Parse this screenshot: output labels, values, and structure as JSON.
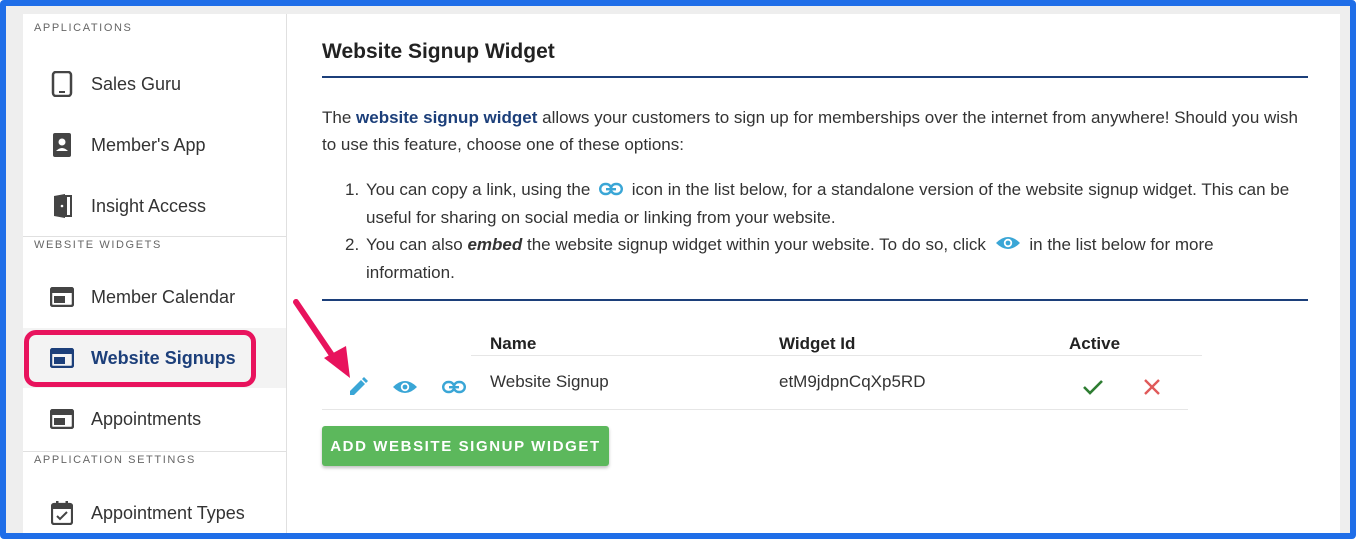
{
  "sidebar": {
    "sections": [
      {
        "title": "APPLICATIONS"
      },
      {
        "title": "WEBSITE WIDGETS"
      },
      {
        "title": "APPLICATION SETTINGS"
      }
    ],
    "items": [
      {
        "label": "Sales Guru",
        "icon": "tablet-icon"
      },
      {
        "label": "Member's App",
        "icon": "phone-id-icon"
      },
      {
        "label": "Insight Access",
        "icon": "door-icon"
      },
      {
        "label": "Member Calendar",
        "icon": "widget-window-icon"
      },
      {
        "label": "Website Signups",
        "icon": "widget-window-icon",
        "active": true
      },
      {
        "label": "Appointments",
        "icon": "widget-window-icon"
      },
      {
        "label": "Appointment Types",
        "icon": "calendar-check-icon"
      }
    ]
  },
  "main": {
    "title": "Website Signup Widget",
    "intro": {
      "prefix": "The ",
      "link": "website signup widget",
      "suffix": " allows your customers to sign up for memberships over the internet from anywhere! Should you wish to use this feature, choose one of these options:"
    },
    "options": [
      {
        "num": "1.",
        "before": "You can copy a link, using the",
        "after": "icon in the list below, for a standalone version of the website signup widget. This can be useful for sharing on social media or linking from your website."
      },
      {
        "num": "2.",
        "before": "You can also ",
        "emphasis": "embed",
        "middle": " the website signup widget within your website. To do so, click",
        "after": "in the list below for more information."
      }
    ],
    "table": {
      "headers": {
        "name": "Name",
        "widget_id": "Widget Id",
        "active": "Active"
      },
      "rows": [
        {
          "name": "Website Signup",
          "widget_id": "etM9jdpnCqXp5RD",
          "active": true
        }
      ]
    },
    "add_button": "ADD WEBSITE SIGNUP WIDGET"
  },
  "colors": {
    "frame": "#1f6ee8",
    "accent_navy": "#1c3f7a",
    "icon_blue": "#3aa6d6",
    "success_green": "#5cb85c",
    "check_green": "#2e7d32",
    "delete_red": "#e05a5a",
    "annotation_pink": "#e8135d"
  }
}
